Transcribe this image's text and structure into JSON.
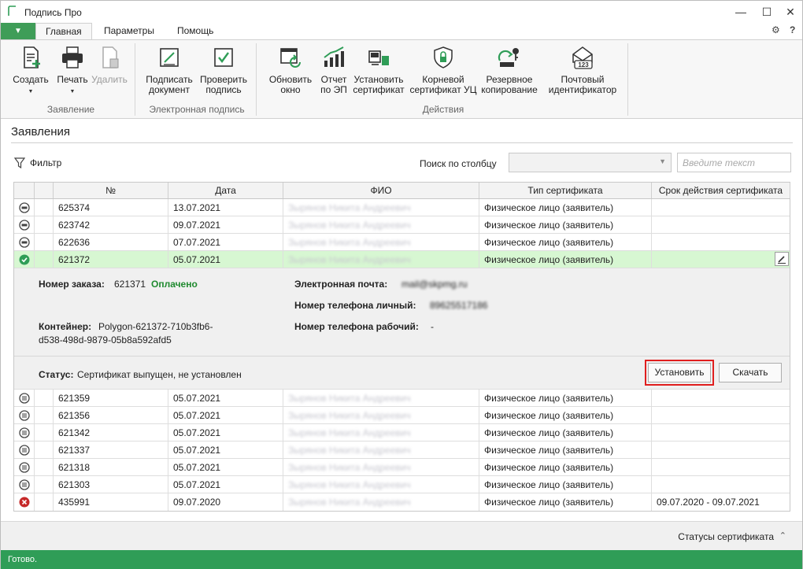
{
  "window": {
    "title": "Подпись Про",
    "minimize": "—",
    "maximize": "☐",
    "close": "✕"
  },
  "menu": {
    "app_button": "▼",
    "tabs": [
      "Главная",
      "Параметры",
      "Помощь"
    ],
    "active_tab": "Главная",
    "right_icons": [
      "settings-icon",
      "help-icon"
    ]
  },
  "ribbon": {
    "groups": [
      {
        "label": "Заявление",
        "buttons": [
          {
            "label": "Создать",
            "icon": "new-document-icon",
            "dropdown": true
          },
          {
            "label": "Печать",
            "icon": "printer-icon",
            "dropdown": true
          },
          {
            "label": "Удалить",
            "icon": "delete-document-icon",
            "disabled": true
          }
        ]
      },
      {
        "label": "Электронная подпись",
        "buttons": [
          {
            "label": "Подписать\nдокумент",
            "icon": "sign-document-icon"
          },
          {
            "label": "Проверить\nподпись",
            "icon": "check-signature-icon"
          }
        ]
      },
      {
        "label": "Действия",
        "buttons": [
          {
            "label": "Обновить\nокно",
            "icon": "refresh-window-icon"
          },
          {
            "label": "Отчет\nпо ЭП",
            "icon": "report-chart-icon"
          },
          {
            "label": "Установить\nсертификат",
            "icon": "install-certificate-icon"
          },
          {
            "label": "Корневой\nсертификат УЦ",
            "icon": "root-certificate-icon"
          },
          {
            "label": "Резервное\nкопирование",
            "icon": "backup-key-icon"
          },
          {
            "label": "Почтовый\nидентификатор",
            "icon": "mail-id-icon"
          }
        ]
      }
    ]
  },
  "main": {
    "section_title": "Заявления",
    "filter_label": "Фильтр",
    "search_label": "Поиск по столбцу",
    "search_select_value": "",
    "search_placeholder": "Введите текст",
    "columns": [
      "",
      "",
      "№",
      "Дата",
      "ФИО",
      "Тип сертификата",
      "Срок действия сертификата"
    ],
    "rows_before": [
      {
        "status": "pending-icon",
        "number": "625374",
        "date": "13.07.2021",
        "name": "Зырянов Никита Андреевич",
        "type": "Физическое лицо (заявитель)",
        "validity": ""
      },
      {
        "status": "pending-icon",
        "number": "623742",
        "date": "09.07.2021",
        "name": "Зырянов Никита Андреевич",
        "type": "Физическое лицо (заявитель)",
        "validity": ""
      },
      {
        "status": "pending-icon",
        "number": "622636",
        "date": "07.07.2021",
        "name": "Зырянов Никита Андреевич",
        "type": "Физическое лицо (заявитель)",
        "validity": ""
      }
    ],
    "selected_row": {
      "status": "issued-check-icon",
      "number": "621372",
      "date": "05.07.2021",
      "name": "Зырянов Никита Андреевич",
      "type": "Физическое лицо (заявитель)",
      "validity": ""
    },
    "details": {
      "order_label": "Номер заказа:",
      "order_number": "621371",
      "order_status": "Оплачено",
      "container_label": "Контейнер:",
      "container_value": "Polygon-621372-710b3fb6-",
      "container_value_2": "d538-498d-9879-05b8a592afd5",
      "email_label": "Электронная почта:",
      "email_value": "mail@skpmg.ru",
      "phone_personal_label": "Номер телефона личный:",
      "phone_personal_value": "89625517186",
      "phone_work_label": "Номер телефона рабочий:",
      "phone_work_value": "-",
      "status_label": "Статус:",
      "status_value": "Сертификат выпущен, не установлен",
      "install_button": "Установить",
      "download_button": "Скачать"
    },
    "rows_after": [
      {
        "status": "list-doc-icon",
        "number": "621359",
        "date": "05.07.2021",
        "name": "Зырянов Никита Андреевич",
        "type": "Физическое лицо (заявитель)",
        "validity": ""
      },
      {
        "status": "list-doc-icon",
        "number": "621356",
        "date": "05.07.2021",
        "name": "Зырянов Никита Андреевич",
        "type": "Физическое лицо (заявитель)",
        "validity": ""
      },
      {
        "status": "list-doc-icon",
        "number": "621342",
        "date": "05.07.2021",
        "name": "Зырянов Никита Андреевич",
        "type": "Физическое лицо (заявитель)",
        "validity": ""
      },
      {
        "status": "list-doc-icon",
        "number": "621337",
        "date": "05.07.2021",
        "name": "Зырянов Никита Андреевич",
        "type": "Физическое лицо (заявитель)",
        "validity": ""
      },
      {
        "status": "list-doc-icon",
        "number": "621318",
        "date": "05.07.2021",
        "name": "Зырянов Никита Андреевич",
        "type": "Физическое лицо (заявитель)",
        "validity": ""
      },
      {
        "status": "list-doc-icon",
        "number": "621303",
        "date": "05.07.2021",
        "name": "Зырянов Никита Андреевич",
        "type": "Физическое лицо (заявитель)",
        "validity": ""
      },
      {
        "status": "revoked-x-icon",
        "number": "435991",
        "date": "09.07.2020",
        "name": "Зырянов Никита Андреевич",
        "type": "Физическое лицо (заявитель)",
        "validity": "09.07.2020 - 09.07.2021"
      }
    ]
  },
  "bottom": {
    "cert_statuses": "Статусы сертификата",
    "chevron": "⌃"
  },
  "statusbar": {
    "text": "Готово."
  },
  "colors": {
    "accent_green": "#2f9d57",
    "selected_row": "#d7f7d2",
    "paid_green": "#1f8a2f",
    "highlight_red": "#e01e1e"
  }
}
